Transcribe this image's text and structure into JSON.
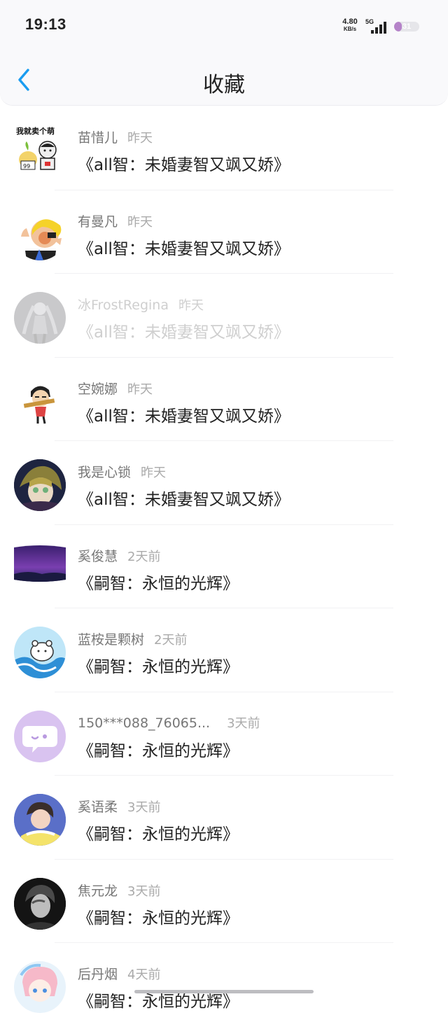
{
  "status_bar": {
    "time": "19:13",
    "net_speed": "4.80",
    "net_unit": "KB/s",
    "net_type": "5G",
    "battery": "31",
    "battery_level": 0.31,
    "battery_color": "#b583c9"
  },
  "header": {
    "title": "收藏",
    "back_icon": "chevron-left-icon",
    "accent": "#1a9cf0"
  },
  "favorites": [
    {
      "name": "苗惜儿",
      "time": "昨天",
      "content": "《all智：未婚妻智又飒又娇》"
    },
    {
      "name": "有曼凡",
      "time": "昨天",
      "content": "《all智：未婚妻智又飒又娇》"
    },
    {
      "name": "冰FrostRegina",
      "time": "昨天",
      "content": "《all智：未婚妻智又飒又娇》"
    },
    {
      "name": "空婉娜",
      "time": "昨天",
      "content": "《all智：未婚妻智又飒又娇》"
    },
    {
      "name": "我是心锁",
      "time": "昨天",
      "content": "《all智：未婚妻智又飒又娇》"
    },
    {
      "name": "奚俊慧",
      "time": "2天前",
      "content": "《嗣智：永恒的光辉》"
    },
    {
      "name": "蓝桉是颗树",
      "time": "2天前",
      "content": "《嗣智：永恒的光辉》"
    },
    {
      "name": "150***088_76065...",
      "time": "3天前",
      "content": "《嗣智：永恒的光辉》"
    },
    {
      "name": "奚语柔",
      "time": "3天前",
      "content": "《嗣智：永恒的光辉》"
    },
    {
      "name": "焦元龙",
      "time": "3天前",
      "content": "《嗣智：永恒的光辉》"
    },
    {
      "name": "后丹烟",
      "time": "4天前",
      "content": "《嗣智：永恒的光辉》"
    }
  ],
  "avatar_sticker_text": "我就卖个萌",
  "avatar_sticker_sub": "萌",
  "avatar_sticker_num": "99"
}
